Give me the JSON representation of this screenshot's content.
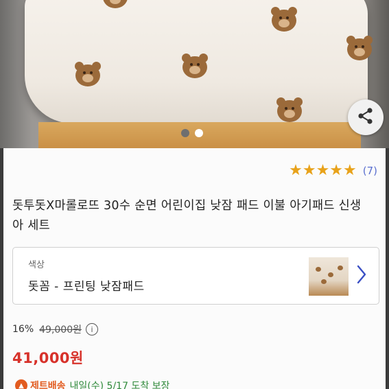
{
  "product": {
    "rating_stars": "★★★★★",
    "review_count": "(7)",
    "title": "돗투돗X마롤로뜨 30수 순면 어린이집 낮잠 패드 이불 아기패드 신생아 세트",
    "image_carousel": {
      "total": 2,
      "current": 1
    }
  },
  "option": {
    "label": "색상",
    "value": "돗꼼 - 프린팅 낮잠패드"
  },
  "pricing": {
    "discount": "16%",
    "original_price": "49,000원",
    "info_icon_glyph": "i",
    "sale_price": "41,000원"
  },
  "delivery": {
    "brand": "제트배송",
    "date_text": "내일(수) 5/17 도착 보장"
  },
  "colors": {
    "accent_red": "#d7322b",
    "star_orange": "#e8a21a",
    "review_blue": "#5a6fcf",
    "delivery_orange": "#e25b1f"
  },
  "icons": {
    "share": "share-icon",
    "chevron": "chevron-right-icon",
    "info": "info-icon"
  }
}
